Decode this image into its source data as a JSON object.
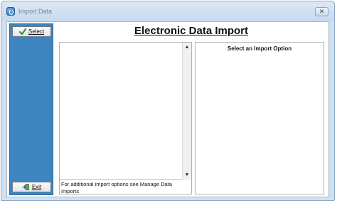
{
  "window": {
    "title": "Import Data",
    "close_glyph": "✕"
  },
  "sidebar": {
    "select_label": "Select",
    "select_icon": "check-icon",
    "exit_label": "Exit",
    "exit_icon": "exit-door-icon"
  },
  "main": {
    "heading": "Electronic Data Import",
    "list": {
      "items": [],
      "footnote": "For additional import options see Manage Data Imports"
    },
    "options": {
      "title": "Select an Import Option"
    }
  },
  "colors": {
    "sidebar": "#3d85c0",
    "window_frame": "#cfe0f1"
  }
}
